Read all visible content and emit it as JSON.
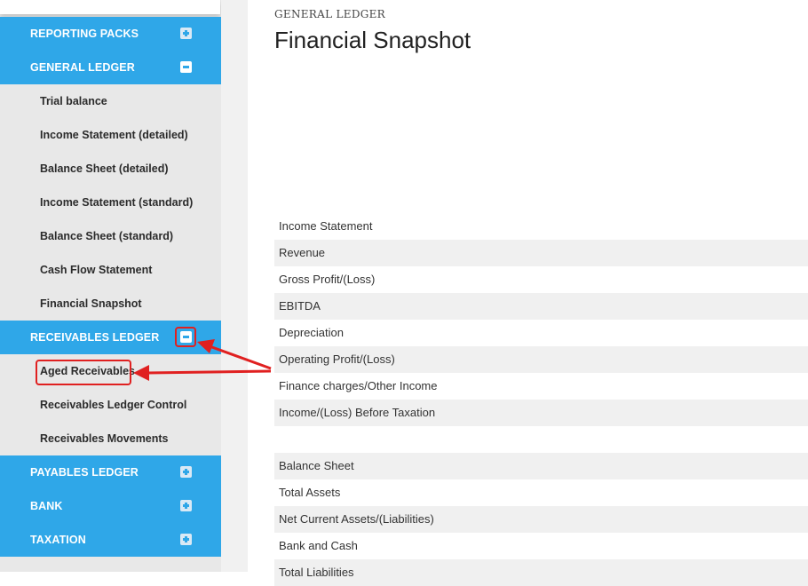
{
  "sidebar": {
    "sections": {
      "reporting_packs": "REPORTING PACKS",
      "general_ledger": "GENERAL LEDGER",
      "receivables_ledger": "RECEIVABLES LEDGER",
      "payables_ledger": "PAYABLES LEDGER",
      "bank": "BANK",
      "taxation": "TAXATION"
    },
    "general_ledger_items": [
      "Trial balance",
      "Income Statement (detailed)",
      "Balance Sheet (detailed)",
      "Income Statement (standard)",
      "Balance Sheet (standard)",
      "Cash Flow Statement",
      "Financial Snapshot"
    ],
    "receivables_items": [
      "Aged Receivables",
      "Receivables Ledger Control",
      "Receivables Movements"
    ]
  },
  "main": {
    "kicker": "GENERAL LEDGER",
    "title": "Financial Snapshot",
    "income_rows": [
      "Income Statement",
      "Revenue",
      "Gross Profit/(Loss)",
      "EBITDA",
      "Depreciation",
      "Operating Profit/(Loss)",
      "Finance charges/Other Income",
      "Income/(Loss) Before Taxation"
    ],
    "balance_rows": [
      "Balance Sheet",
      "Total Assets",
      "Net Current Assets/(Liabilities)",
      "Bank and Cash",
      "Total Liabilities"
    ]
  },
  "colors": {
    "section_blue": "#2fa7e8",
    "sidebar_bg": "#e8e8e8",
    "highlight_red": "#e02020"
  },
  "icons": {
    "expand": "plus-square-icon",
    "collapse": "minus-square-icon",
    "annotation": "red-arrow-icon"
  }
}
